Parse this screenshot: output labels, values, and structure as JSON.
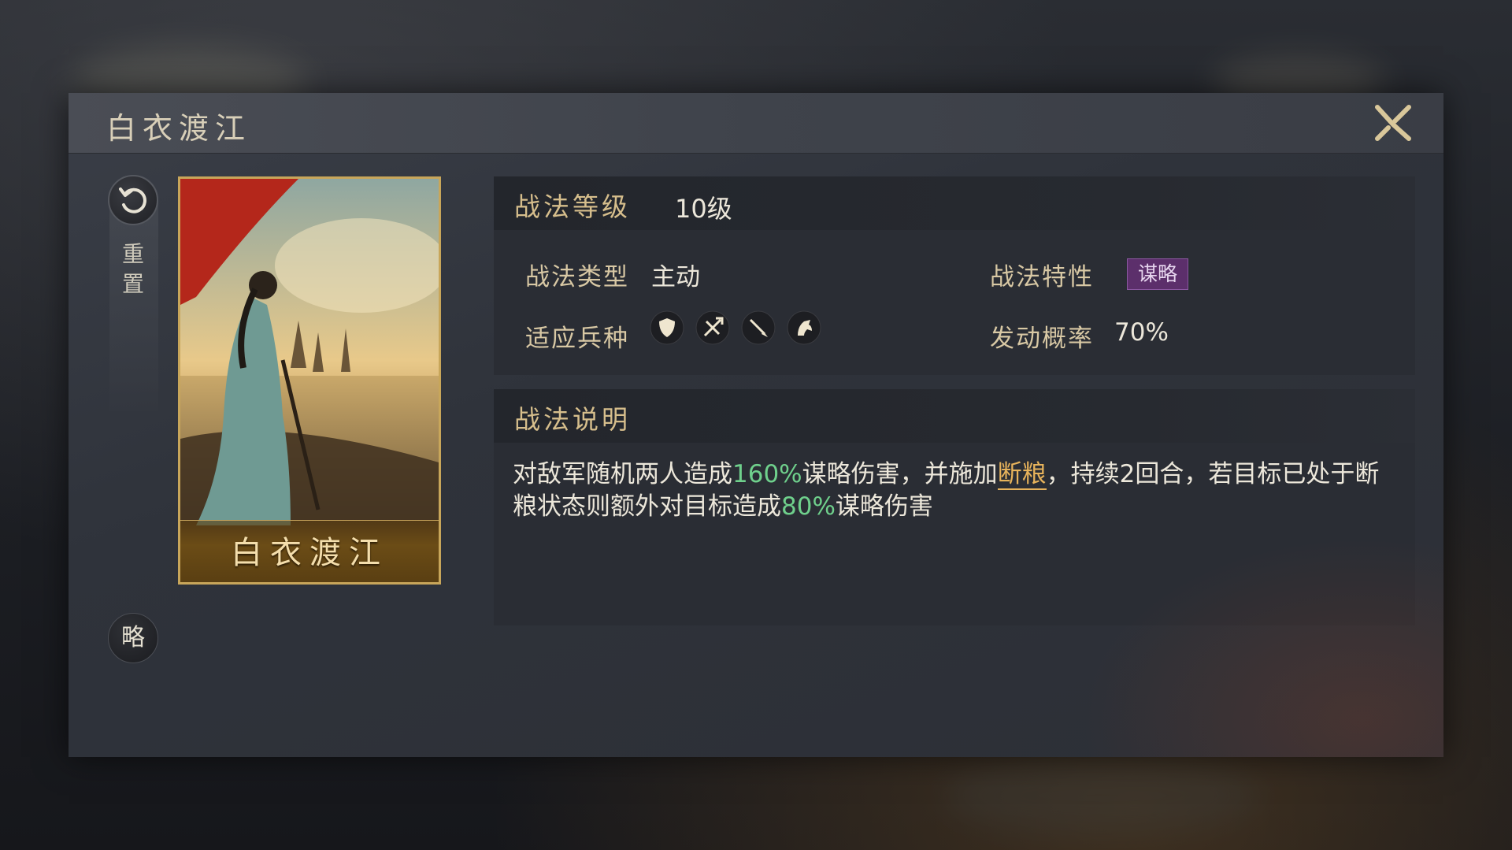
{
  "dialog": {
    "title": "白衣渡江"
  },
  "sidebar": {
    "reset_label": "重\n置",
    "strategy_button": "略"
  },
  "card": {
    "name": "白衣渡江"
  },
  "level": {
    "label": "战法等级",
    "value": "10级"
  },
  "info": {
    "type_label": "战法类型",
    "type_value": "主动",
    "trait_label": "战法特性",
    "trait_value": "谋略",
    "troops_label": "适应兵种",
    "troop_icons": [
      "shield-icon",
      "bow-icon",
      "spear-icon",
      "horse-icon"
    ],
    "rate_label": "发动概率",
    "rate_value": "70%"
  },
  "description": {
    "label": "战法说明",
    "parts": {
      "p1": "对敌军随机两人造成",
      "p2": "160%",
      "p3": "谋略伤害，并施加",
      "p4": "断粮",
      "p5": "，持续2回合，若目标已处于断粮状态则额外对目标造成",
      "p6": "80%",
      "p7": "谋略伤害"
    }
  },
  "colors": {
    "accent_gold": "#d6be8c",
    "highlight_green": "#6fd08c",
    "highlight_orange": "#e7b35b",
    "trait_purple": "#5c2f6b"
  }
}
